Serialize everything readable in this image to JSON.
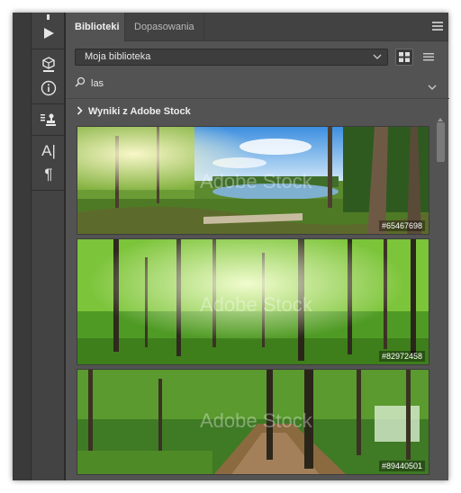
{
  "tools": [
    {
      "name": "play-icon"
    },
    {
      "name": "3d-cube-icon"
    },
    {
      "name": "info-icon"
    },
    {
      "name": "clone-source-icon"
    },
    {
      "name": "character-icon",
      "glyph": "A|"
    },
    {
      "name": "paragraph-icon",
      "glyph": "¶"
    }
  ],
  "tabs": {
    "active": "Biblioteki",
    "inactive": "Dopasowania"
  },
  "library": {
    "selected": "Moja biblioteka"
  },
  "search": {
    "value": "las"
  },
  "results": {
    "header": "Wyniki z Adobe Stock",
    "watermark": "Adobe Stock",
    "items": [
      {
        "id": "#65467698"
      },
      {
        "id": "#82972458"
      },
      {
        "id": "#89440501"
      }
    ]
  },
  "colors": {
    "panel": "#535353",
    "tabbar": "#424242",
    "toolstrip": "#434343"
  }
}
